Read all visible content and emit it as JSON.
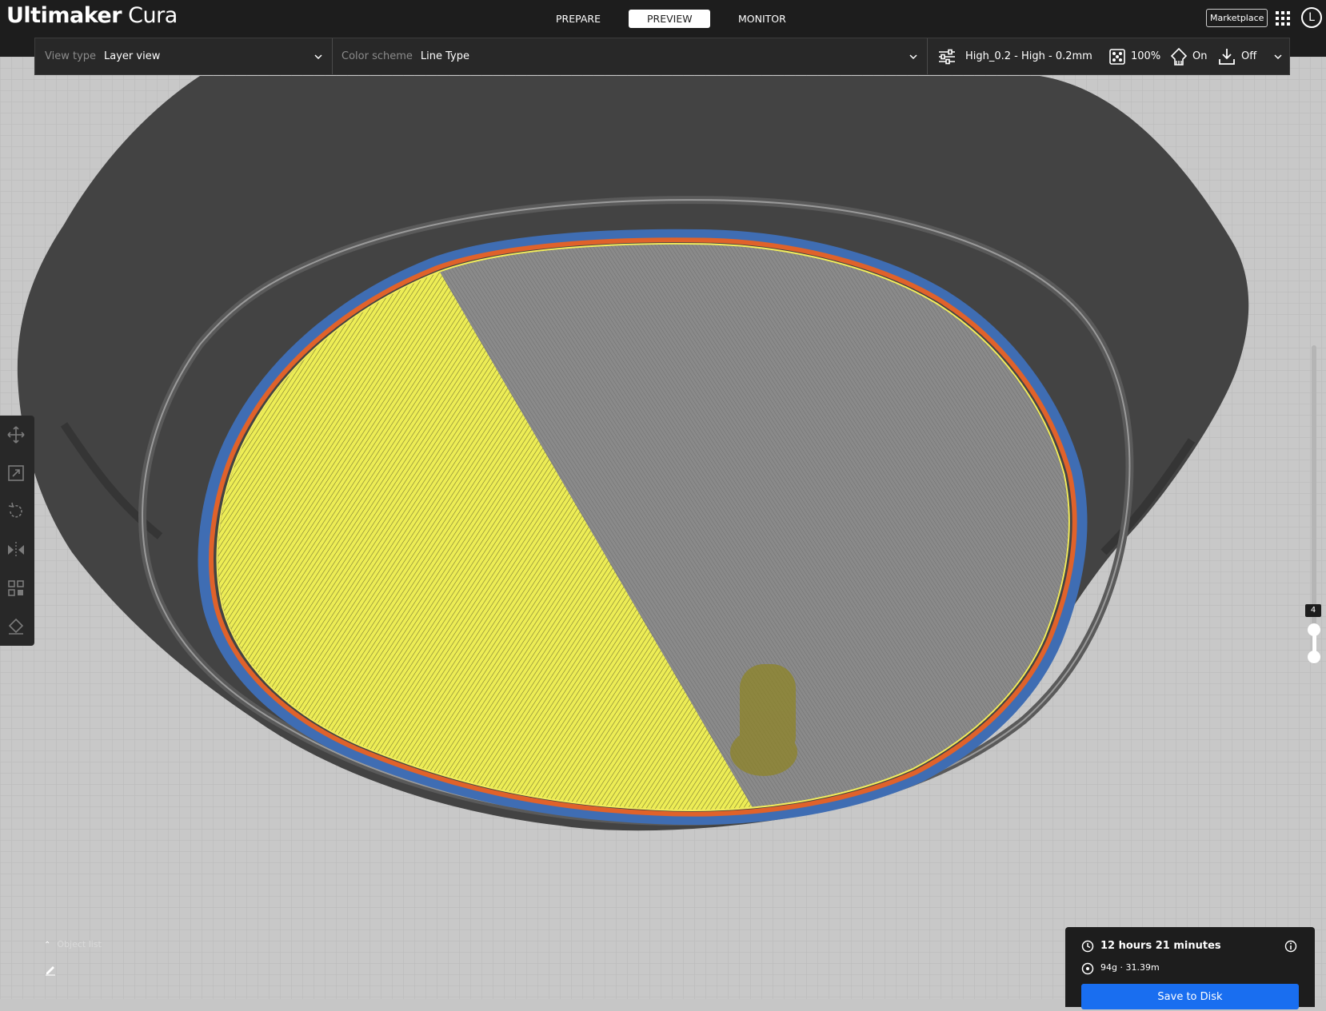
{
  "app": {
    "brand_bold": "Ultimaker",
    "brand_light": "Cura"
  },
  "stages": [
    {
      "label": "PREPARE",
      "active": false
    },
    {
      "label": "PREVIEW",
      "active": true
    },
    {
      "label": "MONITOR",
      "active": false
    }
  ],
  "header": {
    "marketplace_label": "Marketplace",
    "account_initial": "L"
  },
  "viewbar": {
    "view_type_label": "View type",
    "view_type_value": "Layer view",
    "color_scheme_label": "Color scheme",
    "color_scheme_value": "Line Type",
    "profile": "High_0.2 - High - 0.2mm",
    "infill": "100%",
    "support": "On",
    "adhesion": "Off"
  },
  "tools": [
    {
      "name": "move-icon"
    },
    {
      "name": "scale-icon"
    },
    {
      "name": "rotate-icon"
    },
    {
      "name": "mirror-icon"
    },
    {
      "name": "per-model-settings-icon"
    },
    {
      "name": "support-blocker-icon"
    }
  ],
  "layer_slider": {
    "current_layer": "4"
  },
  "object_list": {
    "label": "Object list"
  },
  "print_info": {
    "time": "12 hours 21 minutes",
    "material": "94g · 31.39m",
    "save_label": "Save to Disk"
  },
  "colors": {
    "header_bg": "#1d1d1d",
    "toolbar_bg": "#282828",
    "accent_blue": "#196ef0",
    "shell_blue": "#3f6db3",
    "wall_orange": "#e0622a",
    "top_bottom_yellow": "#f4ee5c",
    "infill_grey": "#8c8c8c",
    "skirt_grey": "#595959"
  }
}
